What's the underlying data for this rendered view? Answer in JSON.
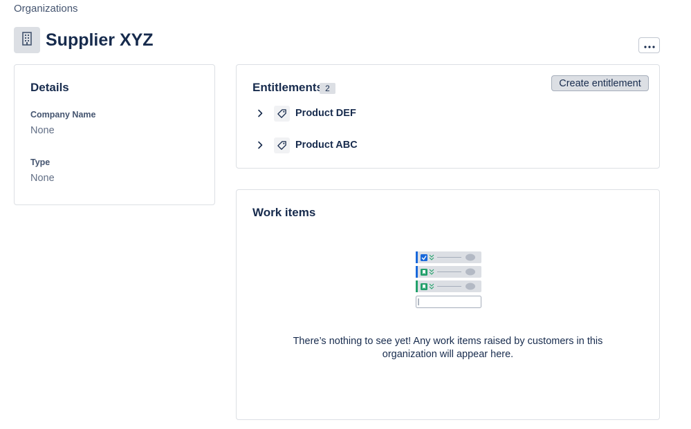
{
  "breadcrumb": {
    "label": "Organizations"
  },
  "header": {
    "title": "Supplier XYZ",
    "more_icon": "more-horizontal-icon",
    "avatar_icon": "building-icon"
  },
  "details": {
    "title": "Details",
    "fields": [
      {
        "label": "Company Name",
        "value": "None"
      },
      {
        "label": "Type",
        "value": "None"
      }
    ]
  },
  "entitlements": {
    "title": "Entitlements",
    "count": "2",
    "create_label": "Create entitlement",
    "items": [
      {
        "name": "Product DEF",
        "icon": "tag-icon"
      },
      {
        "name": "Product ABC",
        "icon": "tag-icon"
      }
    ]
  },
  "work_items": {
    "title": "Work items",
    "empty_message": "There’s nothing to see yet! Any work items raised by customers in this organization will appear here."
  },
  "colors": {
    "text": "#172b4d",
    "subtle": "#44546f",
    "blue": "#1868db",
    "green": "#22a06b",
    "row_bg": "#dcdfe4"
  }
}
